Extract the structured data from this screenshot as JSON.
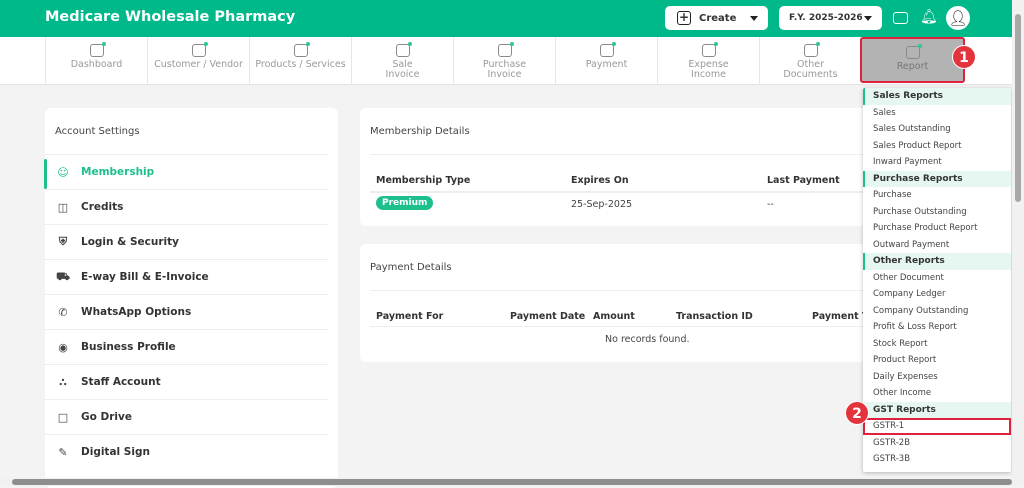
{
  "header": {
    "title": "Medicare Wholesale Pharmacy",
    "create_label": "Create",
    "fy_label": "F.Y. 2025-2026"
  },
  "nav": [
    {
      "label": "Dashboard"
    },
    {
      "label": "Customer / Vendor"
    },
    {
      "label": "Products / Services"
    },
    {
      "label": "Sale Invoice"
    },
    {
      "label": "Purchase Invoice"
    },
    {
      "label": "Payment"
    },
    {
      "label": "Expense Income"
    },
    {
      "label": "Other Documents"
    },
    {
      "label": "Report"
    }
  ],
  "annotations": [
    "1",
    "2"
  ],
  "settings": {
    "title": "Account Settings",
    "items": [
      {
        "label": "Membership",
        "icon": "user-badge-icon"
      },
      {
        "label": "Credits",
        "icon": "coins-icon"
      },
      {
        "label": "Login & Security",
        "icon": "shield-icon"
      },
      {
        "label": "E-way Bill & E-Invoice",
        "icon": "truck-icon"
      },
      {
        "label": "WhatsApp Options",
        "icon": "whatsapp-icon"
      },
      {
        "label": "Business Profile",
        "icon": "user-circle-icon"
      },
      {
        "label": "Staff Account",
        "icon": "users-icon"
      },
      {
        "label": "Go Drive",
        "icon": "folder-icon"
      },
      {
        "label": "Digital Sign",
        "icon": "sign-icon"
      }
    ]
  },
  "membership": {
    "title": "Membership Details",
    "headers": [
      "Membership Type",
      "Expires On",
      "Last Payment"
    ],
    "type": "Premium",
    "expires": "25-Sep-2025",
    "last_payment": "--"
  },
  "payment": {
    "title": "Payment Details",
    "headers": [
      "Payment For",
      "Payment Date",
      "Amount",
      "Transaction ID",
      "Payment Type"
    ],
    "empty": "No records found."
  },
  "report_menu": [
    {
      "heading": "Sales Reports",
      "items": [
        "Sales",
        "Sales Outstanding",
        "Sales Product Report",
        "Inward Payment"
      ]
    },
    {
      "heading": "Purchase Reports",
      "items": [
        "Purchase",
        "Purchase Outstanding",
        "Purchase Product Report",
        "Outward Payment"
      ]
    },
    {
      "heading": "Other Reports",
      "items": [
        "Other Document",
        "Company Ledger",
        "Company Outstanding",
        "Profit & Loss Report",
        "Stock Report",
        "Product Report",
        "Daily Expenses",
        "Other Income"
      ]
    },
    {
      "heading": "GST Reports",
      "items": [
        "GSTR-1",
        "GSTR-2B",
        "GSTR-3B"
      ]
    }
  ],
  "colors": {
    "brand": "#00b98a",
    "highlight": "#e0213b"
  }
}
